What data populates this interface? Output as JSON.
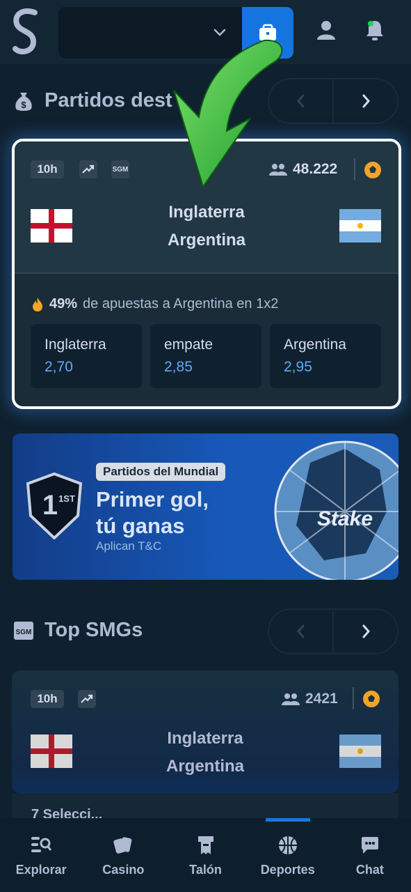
{
  "header": {
    "logo": "S",
    "balance_value": "",
    "icons": [
      "chevron-down-icon",
      "wallet-icon",
      "user-icon",
      "bell-icon"
    ]
  },
  "featured": {
    "title": "Partidos dest",
    "card": {
      "time": "10h",
      "viewers": "48.222",
      "home": "Inglaterra",
      "away": "Argentina",
      "percent": "49%",
      "percent_text": "de apuestas a Argentina en 1x2",
      "odds": [
        {
          "name": "Inglaterra",
          "value": "2,70"
        },
        {
          "name": "empate",
          "value": "2,85"
        },
        {
          "name": "Argentina",
          "value": "2,95"
        }
      ]
    }
  },
  "banner": {
    "pill": "Partidos del Mundial",
    "headline_1": "Primer gol,",
    "headline_2": "tú ganas",
    "sub": "Aplican T&C",
    "badge": "1ST",
    "ball_text": "Stake"
  },
  "top_smgs": {
    "title": "Top SMGs",
    "card": {
      "time": "10h",
      "viewers": "2421",
      "home": "Inglaterra",
      "away": "Argentina"
    },
    "cut_text": "7 Selecci..."
  },
  "bottom_nav": [
    {
      "label": "Explorar",
      "icon": "search-list-icon"
    },
    {
      "label": "Casino",
      "icon": "cards-icon"
    },
    {
      "label": "Talón",
      "icon": "betslip-icon"
    },
    {
      "label": "Deportes",
      "icon": "basketball-icon",
      "active": true
    },
    {
      "label": "Chat",
      "icon": "chat-icon"
    }
  ],
  "colors": {
    "bg": "#0f212e",
    "card": "#213743",
    "accent": "#1475e1",
    "odd_value": "#5da9ff",
    "arrow": "#3cc43c"
  }
}
